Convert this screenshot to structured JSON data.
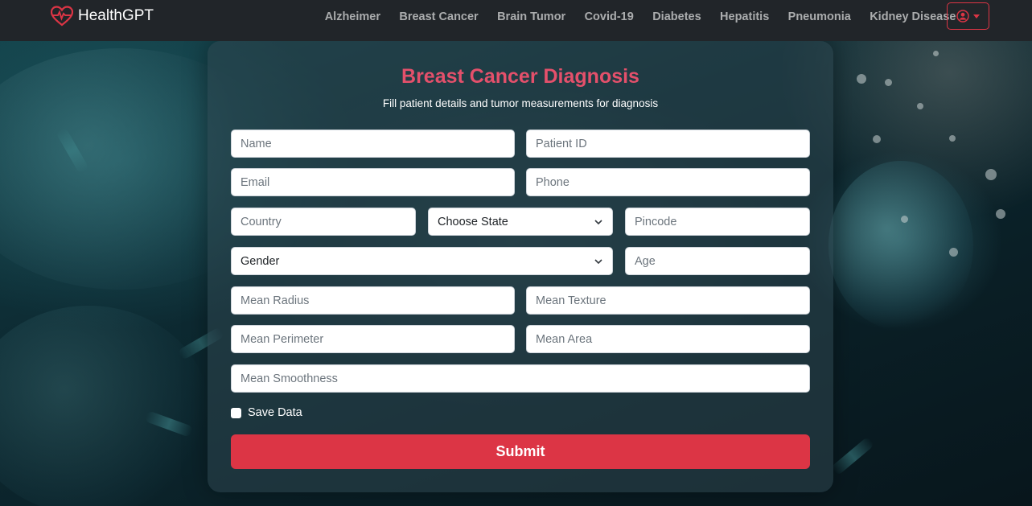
{
  "brand": {
    "name": "HealthGPT",
    "icon": "heart-pulse-icon"
  },
  "nav": {
    "links": [
      "Alzheimer",
      "Breast Cancer",
      "Brain Tumor",
      "Covid-19",
      "Diabetes",
      "Hepatitis",
      "Pneumonia",
      "Kidney Disease"
    ]
  },
  "user_menu": {
    "icon": "user-circle-icon"
  },
  "form": {
    "title": "Breast Cancer Diagnosis",
    "subtitle": "Fill patient details and tumor measurements for diagnosis",
    "placeholders": {
      "name": "Name",
      "patient_id": "Patient ID",
      "email": "Email",
      "phone": "Phone",
      "country": "Country",
      "pincode": "Pincode",
      "age": "Age",
      "mean_radius": "Mean Radius",
      "mean_texture": "Mean Texture",
      "mean_perimeter": "Mean Perimeter",
      "mean_area": "Mean Area",
      "mean_smoothness": "Mean Smoothness"
    },
    "state_select": "Choose State",
    "gender_select": "Gender",
    "save_label": "Save Data",
    "submit_label": "Submit"
  },
  "colors": {
    "accent": "#dc3545",
    "title": "#e4506b",
    "navbar": "#212529"
  }
}
